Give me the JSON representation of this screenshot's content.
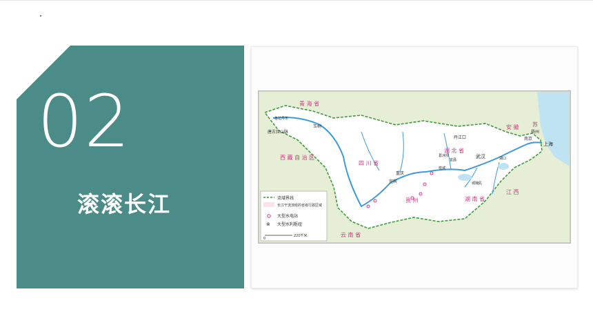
{
  "section": {
    "number": "02",
    "title": "滚滚长江"
  },
  "map": {
    "provinces": {
      "qinghai": "青 海 省",
      "xizang": "西 藏 自 治 区",
      "sichuan": "四 川 省",
      "hubei": "湖 北 省",
      "hunan": "湖 南 省",
      "jiangxi": "江 西",
      "anhui": "安 徽",
      "jiangsu": "苏",
      "yunnan": "云 南 省",
      "guizhou": "贵 州",
      "shanghai": "上海"
    },
    "places": {
      "danjiangkou": "丹江口",
      "wuhan": "武汉",
      "chongqing": "重庆",
      "yibin": "宜宾",
      "nanjing": "南京",
      "yangzhou": "扬州",
      "gezhouba": "葛洲坝",
      "zhicheng": "枝城",
      "chenglingji": "城陵矶",
      "hukou": "湖口",
      "yichang": "宜昌",
      "shanghai_city": "上海",
      "yushu": "玉树",
      "geladandong": "各拉丹冬",
      "tanggula": "唐古拉山脉"
    },
    "legend": {
      "basin_boundary": "流域界线",
      "provinces_label": "长江干流流经的省级行政区域",
      "hydro_station": "大型水电站",
      "hydro_hub": "大型水利枢纽",
      "scale_zero": "0",
      "scale_value": "220千米"
    },
    "colors": {
      "basin_fill": "#ffffff",
      "outside_fill": "#e6efd6",
      "boundary": "#3e9a3a",
      "river": "#3d9ad6",
      "province_text": "#d63384",
      "sea": "#bfe3f2"
    }
  }
}
